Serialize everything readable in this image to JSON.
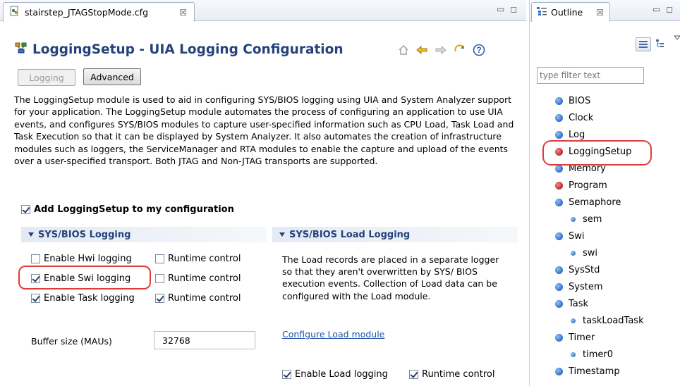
{
  "editor": {
    "tab_title": "stairstep_JTAGStopMode.cfg",
    "tab_close": "☒"
  },
  "header": {
    "title": "LoggingSetup - UIA Logging Configuration",
    "help_label": "?"
  },
  "page_tabs": [
    {
      "label": "Logging",
      "enabled": false
    },
    {
      "label": "Advanced",
      "enabled": true,
      "active": true
    }
  ],
  "description": "The LoggingSetup module is used to aid in configuring SYS/BIOS logging using UIA and System Analyzer support for your application. The LoggingSetup module automates the process of configuring an application to use UIA events, and configures SYS/BIOS modules to capture user-specified information such as CPU Load, Task Load and Task Execution so that it can be displayed by System Analyzer. It also automates the creation of infrastructure modules such as loggers, the ServiceManager and RTA modules to enable the capture and upload of the events over a user-specified transport. Both JTAG and Non-JTAG transports are supported.",
  "add_to_config": {
    "label": "Add LoggingSetup to my configuration",
    "checked": true
  },
  "sysbios_logging": {
    "title": "SYS/BIOS Logging",
    "rows": [
      {
        "label": "Enable Hwi logging",
        "checked": false,
        "runtime_label": "Runtime control",
        "runtime_checked": false
      },
      {
        "label": "Enable Swi logging",
        "checked": true,
        "runtime_label": "Runtime control",
        "runtime_checked": false
      },
      {
        "label": "Enable Task logging",
        "checked": true,
        "runtime_label": "Runtime control",
        "runtime_checked": true
      }
    ],
    "buffer_label": "Buffer size (MAUs)",
    "buffer_value": "32768"
  },
  "load_logging": {
    "title": "SYS/BIOS Load Logging",
    "description": "The Load records are placed in a separate logger so that they aren't overwritten by SYS/ BIOS execution events. Collection of Load data can be configured with the Load module.",
    "link": "Configure Load module",
    "enable_label": "Enable Load logging",
    "enable_checked": true,
    "runtime_label": "Runtime control",
    "runtime_checked": true
  },
  "outline": {
    "tab_title": "Outline",
    "tab_close": "☒",
    "filter_placeholder": "type filter text",
    "items": [
      {
        "label": "BIOS",
        "kind": "module",
        "color": "#2f6fc4"
      },
      {
        "label": "Clock",
        "kind": "module",
        "color": "#2f6fc4"
      },
      {
        "label": "Log",
        "kind": "module",
        "color": "#2f6fc4"
      },
      {
        "label": "LoggingSetup",
        "kind": "module",
        "color": "#b52c2c"
      },
      {
        "label": "Memory",
        "kind": "module",
        "color": "#2f6fc4"
      },
      {
        "label": "Program",
        "kind": "module",
        "color": "#b52c2c"
      },
      {
        "label": "Semaphore",
        "kind": "module",
        "color": "#2f6fc4"
      },
      {
        "label": "sem",
        "kind": "instance",
        "color": "#3a78c8"
      },
      {
        "label": "Swi",
        "kind": "module",
        "color": "#2f6fc4"
      },
      {
        "label": "swi",
        "kind": "instance",
        "color": "#3a78c8"
      },
      {
        "label": "SysStd",
        "kind": "module",
        "color": "#2f6fc4"
      },
      {
        "label": "System",
        "kind": "module",
        "color": "#2f6fc4"
      },
      {
        "label": "Task",
        "kind": "module",
        "color": "#2f6fc4"
      },
      {
        "label": "taskLoadTask",
        "kind": "instance",
        "color": "#3a78c8"
      },
      {
        "label": "Timer",
        "kind": "module",
        "color": "#2f6fc4"
      },
      {
        "label": "timer0",
        "kind": "instance",
        "color": "#3a78c8"
      },
      {
        "label": "Timestamp",
        "kind": "module",
        "color": "#2f6fc4"
      }
    ]
  },
  "icons": [
    "config-file-icon",
    "module-icon",
    "home-icon",
    "back-arrow-icon",
    "forward-arrow-icon",
    "refresh-icon",
    "help-icon",
    "outline-icon",
    "minimize-icon",
    "maximize-icon",
    "view-menu-icon"
  ],
  "colors": {
    "title": "#26427a",
    "link": "#1d52a8",
    "highlight": "#e03b3b",
    "module_ball": "#2f6fc4",
    "error_ball": "#b52c2c"
  }
}
